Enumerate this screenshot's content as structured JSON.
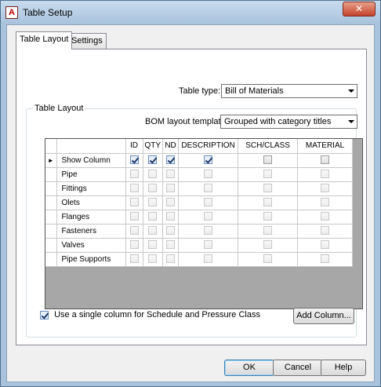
{
  "window": {
    "title": "Table Setup",
    "app_icon": "A",
    "close_glyph": "✕"
  },
  "tabs": [
    {
      "label": "Table Layout",
      "active": true
    },
    {
      "label": "Settings",
      "active": false
    }
  ],
  "table_type": {
    "label": "Table type:",
    "value": "Bill of Materials"
  },
  "group": {
    "title": "Table Layout"
  },
  "bom_template": {
    "label": "BOM layout template:",
    "value": "Grouped with category titles"
  },
  "grid": {
    "columns": [
      "",
      "ID",
      "QTY",
      "ND",
      "DESCRIPTION",
      "SCH/CLASS",
      "MATERIAL"
    ],
    "current_row_marker": "►",
    "rows": [
      {
        "name": "Show Column",
        "checks": [
          true,
          true,
          true,
          true,
          false,
          false
        ],
        "current": true
      },
      {
        "name": "Pipe",
        "checks": [
          false,
          false,
          false,
          false,
          false,
          false
        ]
      },
      {
        "name": "Fittings",
        "checks": [
          false,
          false,
          false,
          false,
          false,
          false
        ]
      },
      {
        "name": "Olets",
        "checks": [
          false,
          false,
          false,
          false,
          false,
          false
        ]
      },
      {
        "name": "Flanges",
        "checks": [
          false,
          false,
          false,
          false,
          false,
          false
        ]
      },
      {
        "name": "Fasteners",
        "checks": [
          false,
          false,
          false,
          false,
          false,
          false
        ]
      },
      {
        "name": "Valves",
        "checks": [
          false,
          false,
          false,
          false,
          false,
          false
        ]
      },
      {
        "name": "Pipe Supports",
        "checks": [
          false,
          false,
          false,
          false,
          false,
          false
        ]
      }
    ]
  },
  "single_column_option": {
    "label": "Use a single column for Schedule and Pressure Class",
    "checked": true
  },
  "buttons": {
    "add_column": "Add Column...",
    "ok": "OK",
    "cancel": "Cancel",
    "help": "Help"
  }
}
